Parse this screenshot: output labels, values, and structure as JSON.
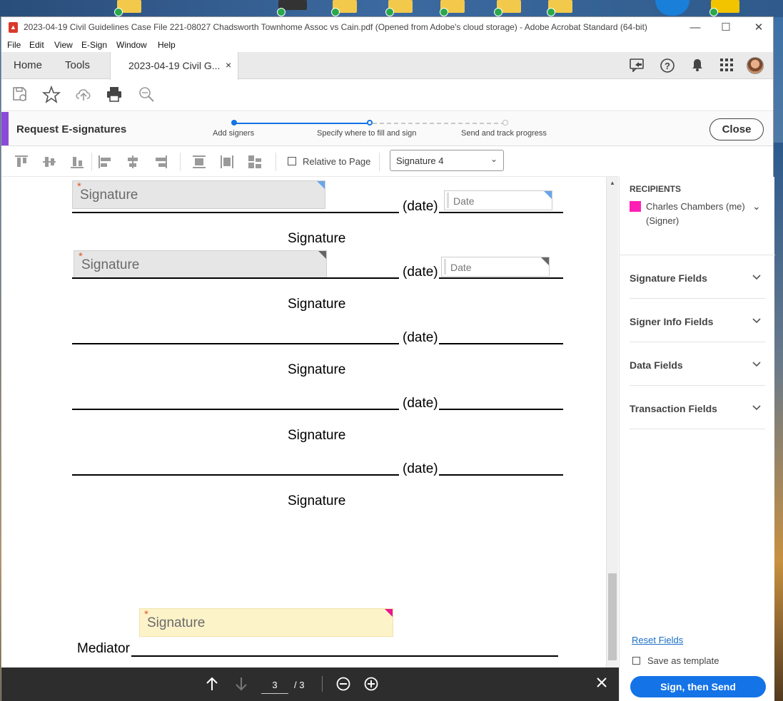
{
  "window": {
    "title": "2023-04-19 Civil Guidelines Case File 221-08027 Chadsworth Townhome Assoc vs Cain.pdf (Opened from Adobe's cloud storage) - Adobe Acrobat Standard (64-bit)",
    "controls": {
      "minimize": "—",
      "maximize": "☐",
      "close": "✕"
    }
  },
  "menu": [
    "File",
    "Edit",
    "View",
    "E-Sign",
    "Window",
    "Help"
  ],
  "tabs": {
    "home": "Home",
    "tools": "Tools",
    "document": "2023-04-19 Civil G...",
    "close": "×"
  },
  "toolbar_icons": [
    "save-cloud-icon",
    "star-icon",
    "upload-icon",
    "print-icon",
    "zoom-icon"
  ],
  "esign": {
    "heading": "Request E-signatures",
    "steps": [
      {
        "label": "Add signers",
        "state": "done"
      },
      {
        "label": "Specify where to fill and sign",
        "state": "current"
      },
      {
        "label": "Send and track progress",
        "state": "pending"
      }
    ],
    "close_label": "Close",
    "accent_color": "#8c4bd6",
    "step_color": "#1473e6"
  },
  "align": {
    "relative_label": "Relative to Page",
    "relative_checked": false,
    "selected_field": "Signature 4",
    "select_chevron": "⌄"
  },
  "document": {
    "date_text": "(date)",
    "signature_caption": "Signature",
    "mediator_label": "Mediator",
    "field_signature_label": "Signature",
    "field_date_label": "Date",
    "required_mark": "*"
  },
  "bottombar": {
    "page_current": "3",
    "page_total": "/ 3"
  },
  "recipients": {
    "heading": "RECIPIENTS",
    "name": "Charles Chambers (me) (Signer)",
    "color": "#ff1fb4",
    "chevron": "⌄"
  },
  "accordions": [
    {
      "label": "Signature Fields"
    },
    {
      "label": "Signer Info Fields"
    },
    {
      "label": "Data Fields"
    },
    {
      "label": "Transaction Fields"
    }
  ],
  "panel_footer": {
    "reset_label": "Reset Fields",
    "template_label": "Save as template",
    "template_checked": false,
    "sign_label": "Sign, then Send"
  }
}
